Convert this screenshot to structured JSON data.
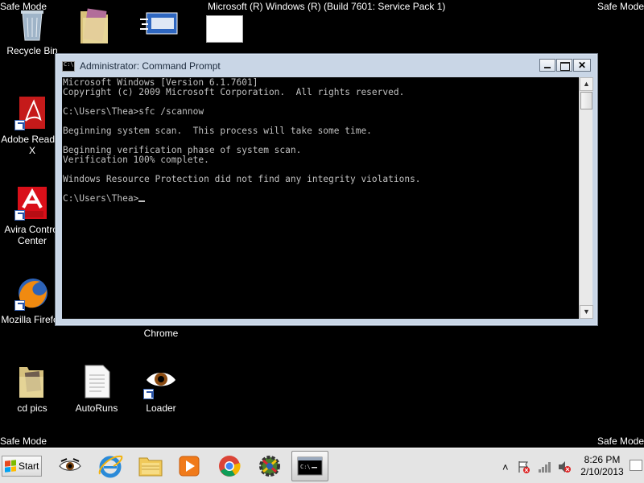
{
  "desktop": {
    "safe_mode_label": "Safe Mode",
    "build_text": "Microsoft (R) Windows (R) (Build 7601: Service Pack 1)",
    "icons": {
      "recycle_bin": "Recycle Bin",
      "adobe_reader": "Adobe Reader X",
      "avira": "Avira Control Center",
      "mozilla": "Mozilla Firefox",
      "chrome": "Chrome",
      "cd_pics": "cd pics",
      "autoruns": "AutoRuns",
      "loader": "Loader"
    }
  },
  "cmd_window": {
    "title": "Administrator: Command Prompt",
    "close_glyph": "✕",
    "scroll_up": "▲",
    "scroll_down": "▼",
    "lines": [
      "Microsoft Windows [Version 6.1.7601]",
      "Copyright (c) 2009 Microsoft Corporation.  All rights reserved.",
      "",
      "C:\\Users\\Thea>sfc /scannow",
      "",
      "Beginning system scan.  This process will take some time.",
      "",
      "Beginning verification phase of system scan.",
      "Verification 100% complete.",
      "",
      "Windows Resource Protection did not find any integrity violations.",
      "",
      "C:\\Users\\Thea>"
    ]
  },
  "taskbar": {
    "start_label": "Start",
    "tray_chevron": "˄",
    "time": "8:26 PM",
    "date": "2/10/2013",
    "pinned": [
      "eye-app",
      "internet-explorer",
      "windows-explorer",
      "media-player",
      "chrome",
      "utility-app",
      "command-prompt"
    ]
  },
  "colors": {
    "console_bg": "#000000",
    "console_text": "#c0c0c0",
    "taskbar_bg": "#e4e4e4",
    "window_frame": "#c9d6e6"
  }
}
